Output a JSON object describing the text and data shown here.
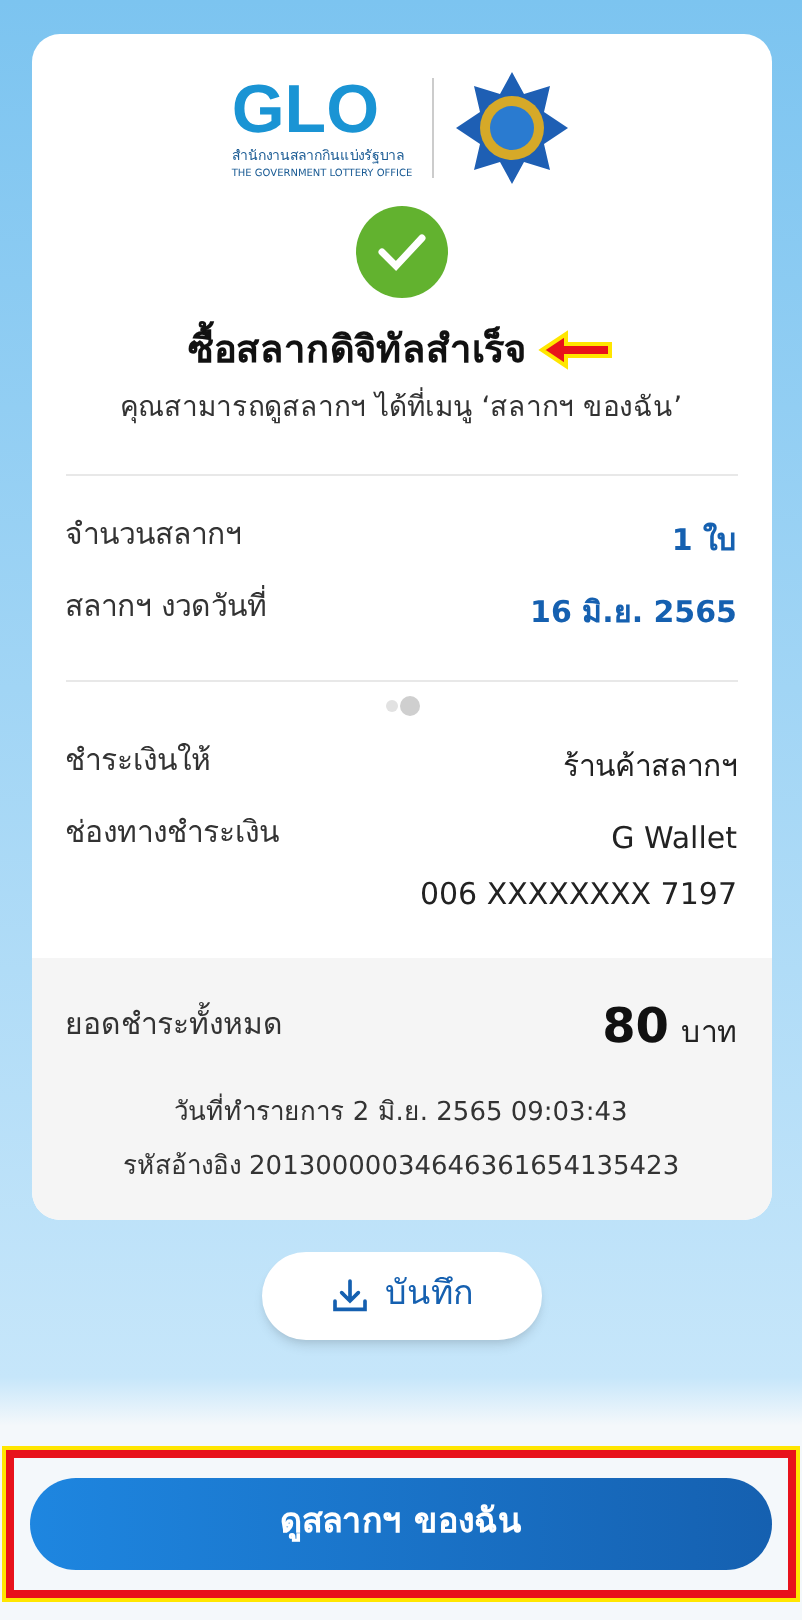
{
  "logo": {
    "wordmark": "GLO",
    "thai_name": "สำนักงานสลากกินแบ่งรัฐบาล",
    "english_name": "THE GOVERNMENT LOTTERY OFFICE"
  },
  "title": "ซื้อสลากดิจิทัลสำเร็จ",
  "subtitle": "คุณสามารถดูสลากฯ ได้ที่เมนู ‘สลากฯ ของฉัน’",
  "ticket_rows": [
    {
      "label": "จำนวนสลากฯ",
      "values": [
        "1 ใบ"
      ],
      "highlight": true
    },
    {
      "label": "สลากฯ งวดวันที่",
      "values": [
        "16 มิ.ย. 2565"
      ],
      "highlight": true
    }
  ],
  "payment_rows": [
    {
      "label": "ชำระเงินให้",
      "values": [
        "ร้านค้าสลากฯ"
      ],
      "highlight": false
    },
    {
      "label": "ช่องทางชำระเงิน",
      "values": [
        "G Wallet",
        "006 XXXXXXXX 7197"
      ],
      "highlight": false
    }
  ],
  "total": {
    "label": "ยอดชำระทั้งหมด",
    "amount": "80",
    "unit": "บาท"
  },
  "transaction_date": "วันที่ทำรายการ 2 มิ.ย. 2565 09:03:43",
  "reference": "รหัสอ้างอิง 20130000034646361654135423",
  "save_button": "บันทึก",
  "primary_button": "ดูสลากฯ ของฉัน"
}
